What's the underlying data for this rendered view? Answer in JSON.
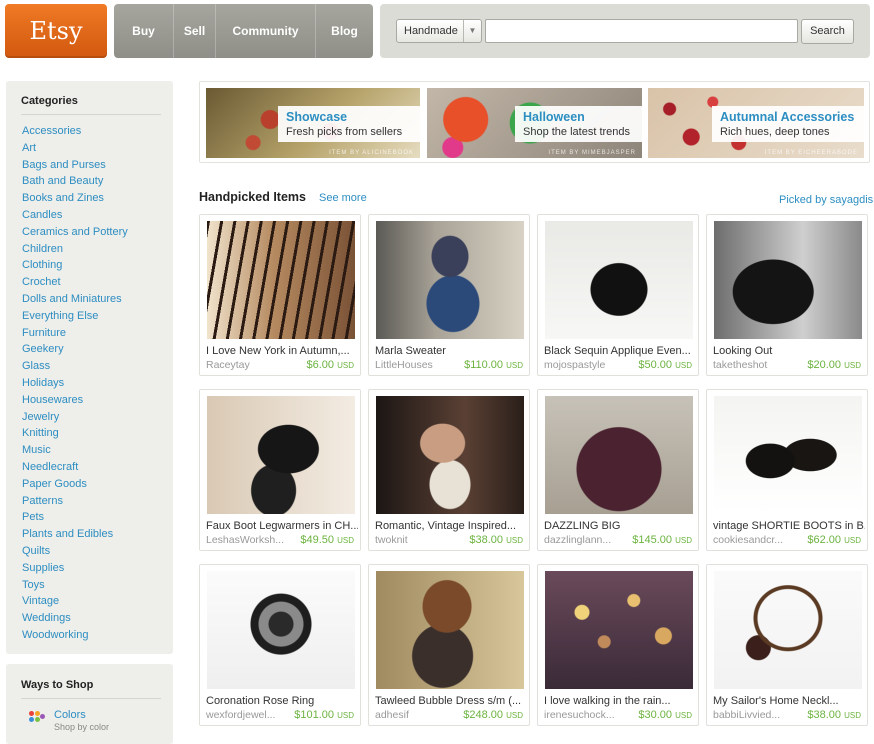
{
  "header": {
    "logo": "Etsy",
    "nav": [
      "Buy",
      "Sell",
      "Community",
      "Blog"
    ],
    "search": {
      "category": "Handmade",
      "query": "",
      "button": "Search"
    }
  },
  "sidebar": {
    "categories_title": "Categories",
    "categories": [
      "Accessories",
      "Art",
      "Bags and Purses",
      "Bath and Beauty",
      "Books and Zines",
      "Candles",
      "Ceramics and Pottery",
      "Children",
      "Clothing",
      "Crochet",
      "Dolls and Miniatures",
      "Everything Else",
      "Furniture",
      "Geekery",
      "Glass",
      "Holidays",
      "Housewares",
      "Jewelry",
      "Knitting",
      "Music",
      "Needlecraft",
      "Paper Goods",
      "Patterns",
      "Pets",
      "Plants and Edibles",
      "Quilts",
      "Supplies",
      "Toys",
      "Vintage",
      "Weddings",
      "Woodworking"
    ],
    "ways_title": "Ways to Shop",
    "ways": [
      {
        "label": "Colors",
        "sub": "Shop by color"
      }
    ]
  },
  "banners": [
    {
      "title": "Showcase",
      "subtitle": "Fresh picks from sellers",
      "credit": "ITEM BY ALICINEBOOK"
    },
    {
      "title": "Halloween",
      "subtitle": "Shop the latest trends",
      "credit": "ITEM BY MIMEBJASPER"
    },
    {
      "title": "Autumnal Accessories",
      "subtitle": "Rich hues, deep tones",
      "credit": "ITEM BY EICHEERABODE"
    }
  ],
  "handpicked": {
    "title": "Handpicked Items",
    "see_more": "See more",
    "picked_by": "Picked by sayagdis"
  },
  "items": [
    {
      "name": "I Love New York in Autumn,...",
      "shop": "Raceytay",
      "price": "$6.00",
      "currency": "USD"
    },
    {
      "name": "Marla Sweater",
      "shop": "LittleHouses",
      "price": "$110.00",
      "currency": "USD"
    },
    {
      "name": "Black Sequin Applique Even...",
      "shop": "mojospastyle",
      "price": "$50.00",
      "currency": "USD"
    },
    {
      "name": "Looking Out",
      "shop": "taketheshot",
      "price": "$20.00",
      "currency": "USD"
    },
    {
      "name": "Faux Boot Legwarmers in CH...",
      "shop": "LeshasWorksh...",
      "price": "$49.50",
      "currency": "USD"
    },
    {
      "name": "Romantic, Vintage Inspired...",
      "shop": "twoknit",
      "price": "$38.00",
      "currency": "USD"
    },
    {
      "name": "DAZZLING BIG",
      "shop": "dazzlinglann...",
      "price": "$145.00",
      "currency": "USD"
    },
    {
      "name": "vintage SHORTIE BOOTS in B...",
      "shop": "cookiesandcr...",
      "price": "$62.00",
      "currency": "USD"
    },
    {
      "name": "Coronation Rose Ring",
      "shop": "wexfordjewel...",
      "price": "$101.00",
      "currency": "USD"
    },
    {
      "name": "Tawleed Bubble Dress s/m (...",
      "shop": "adhesif",
      "price": "$248.00",
      "currency": "USD"
    },
    {
      "name": "I love walking in the rain...",
      "shop": "irenesuchock...",
      "price": "$30.00",
      "currency": "USD"
    },
    {
      "name": "My Sailor's Home Neckl...",
      "shop": "babbiLivvied...",
      "price": "$38.00",
      "currency": "USD"
    }
  ],
  "colors": {
    "brand_orange": "#e46a1c",
    "link_blue": "#2d8ec2",
    "price_green": "#6cb33f"
  }
}
